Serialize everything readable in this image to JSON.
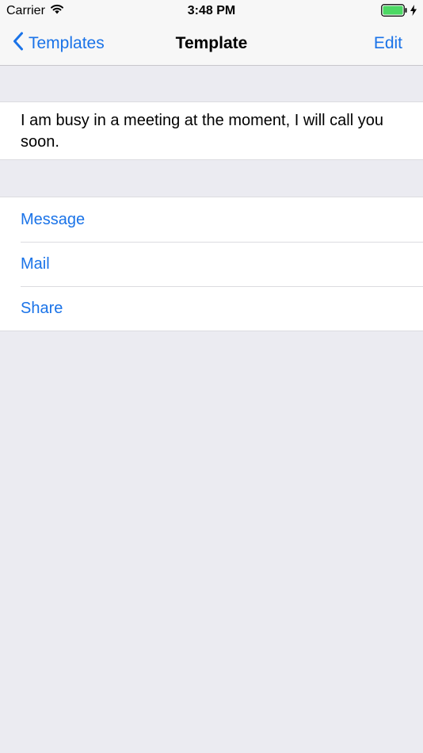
{
  "status_bar": {
    "carrier": "Carrier",
    "time": "3:48 PM",
    "battery_color": "#4cd964"
  },
  "nav_bar": {
    "back_label": "Templates",
    "title": "Template",
    "edit_label": "Edit",
    "accent_color": "#1a73e8"
  },
  "template": {
    "text": "I am busy in a meeting at the moment, I will call you soon."
  },
  "actions": {
    "items": [
      {
        "label": "Message"
      },
      {
        "label": "Mail"
      },
      {
        "label": "Share"
      }
    ]
  }
}
